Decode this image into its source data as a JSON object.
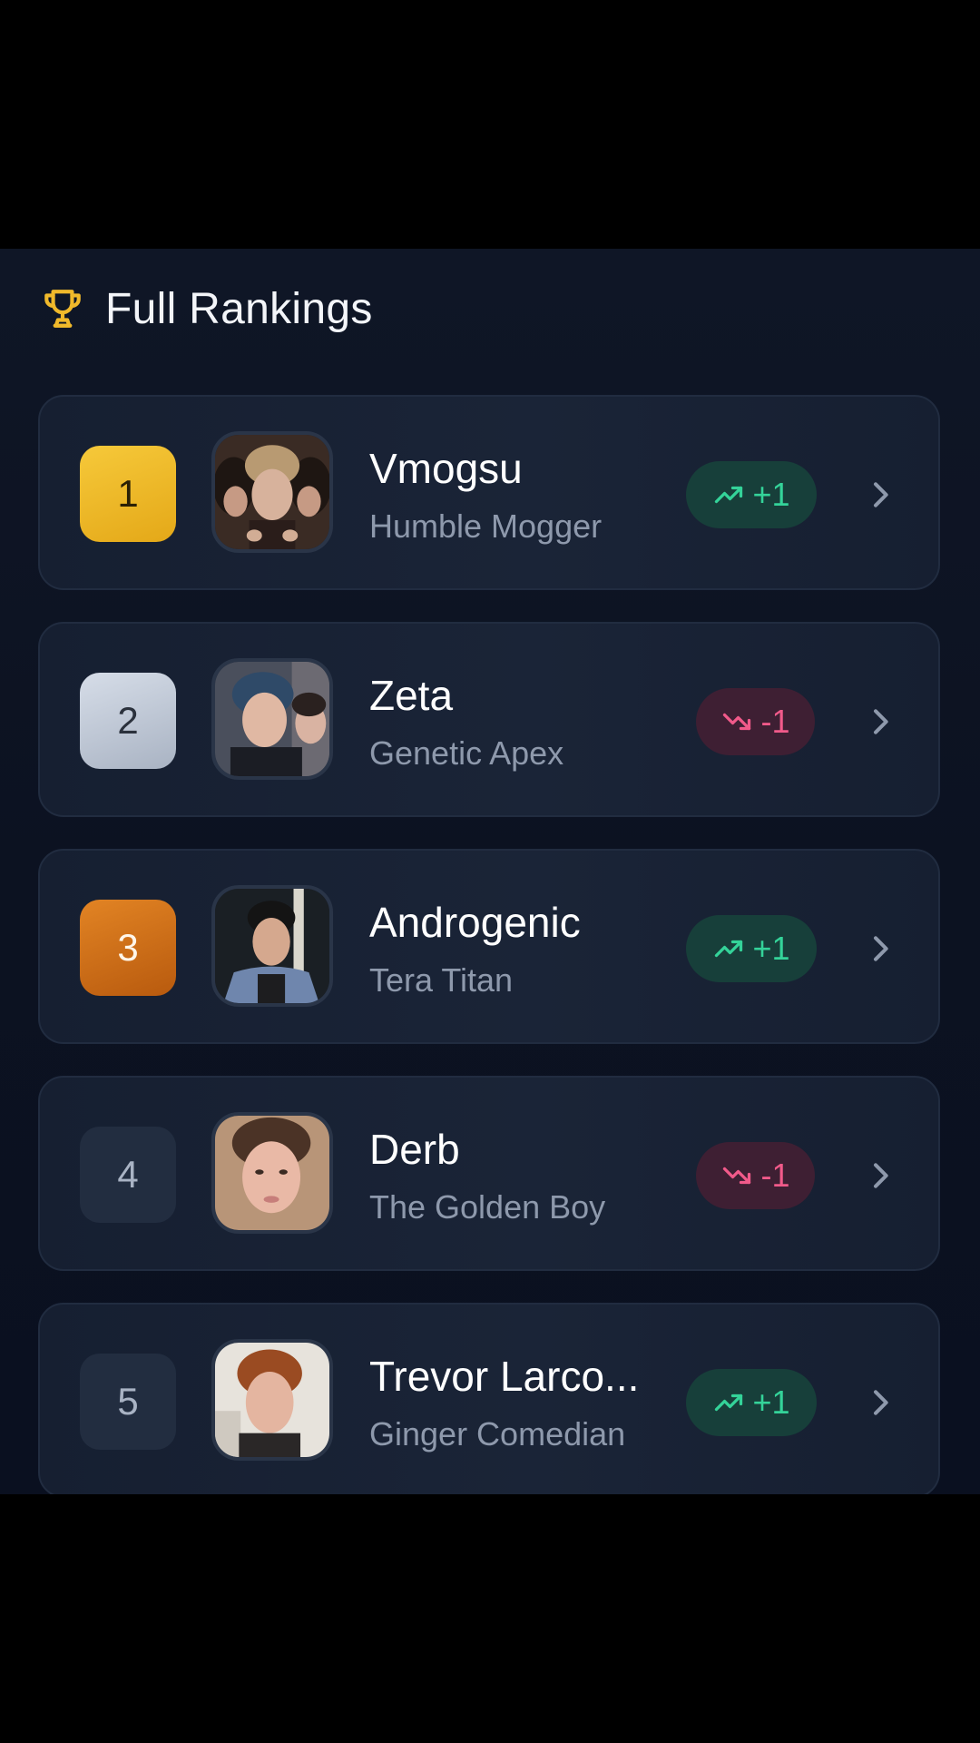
{
  "header": {
    "title": "Full Rankings",
    "icon": "trophy-icon",
    "icon_color": "#f0b92b"
  },
  "rankings": [
    {
      "rank": "1",
      "name": "Vmogsu",
      "subtitle": "Humble Mogger",
      "change": "+1",
      "direction": "up",
      "medal": "gold"
    },
    {
      "rank": "2",
      "name": "Zeta",
      "subtitle": "Genetic Apex",
      "change": "-1",
      "direction": "down",
      "medal": "silver"
    },
    {
      "rank": "3",
      "name": "Androgenic",
      "subtitle": "Tera Titan",
      "change": "+1",
      "direction": "up",
      "medal": "bronze"
    },
    {
      "rank": "4",
      "name": "Derb",
      "subtitle": "The Golden Boy",
      "change": "-1",
      "direction": "down",
      "medal": "none"
    },
    {
      "rank": "5",
      "name": "Trevor Larco...",
      "subtitle": "Ginger Comedian",
      "change": "+1",
      "direction": "up",
      "medal": "none"
    }
  ],
  "colors": {
    "up": "#34d399",
    "down": "#f15a8a",
    "gold": "#f0b92b",
    "silver": "#c3cad6",
    "bronze": "#d2721a"
  }
}
